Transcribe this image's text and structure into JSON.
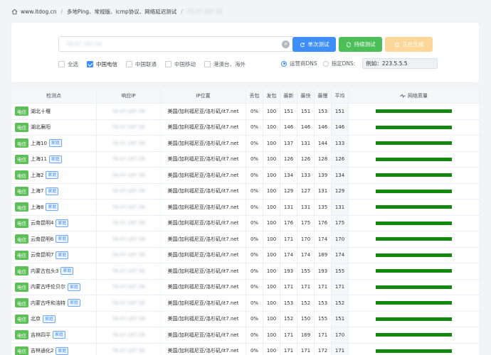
{
  "breadcrumb": {
    "site": "www.itdog.cn",
    "page": "多地Ping、常规版、icmp协议、网络延迟测试",
    "target": "78.47.187.56"
  },
  "search": {
    "value": "78.47.187.56"
  },
  "buttons": {
    "single": "单次测试",
    "continuous": "持续测试",
    "generating": "正在生成"
  },
  "filters": [
    {
      "label": "全选",
      "checked": false
    },
    {
      "label": "中国电信",
      "checked": true
    },
    {
      "label": "中国联通",
      "checked": false
    },
    {
      "label": "中国移动",
      "checked": false
    },
    {
      "label": "港澳台、海外",
      "checked": false
    }
  ],
  "dns": {
    "isp_label": "运营商DNS",
    "custom_label": "指定DNS:",
    "custom_placeholder": "例如：223.5.5.5",
    "selected": "isp"
  },
  "table": {
    "headers": [
      "检测点",
      "响应IP",
      "IP位置",
      "丢包",
      "发包",
      "最新",
      "最快",
      "最慢",
      "平均",
      "网络质量"
    ],
    "rows": [
      {
        "isp": "电信",
        "node": "湖北十堰",
        "home": false,
        "ip": "78.47.187.56",
        "loc": "美国/加利福尼亚/洛杉矶/it7.net",
        "loss": "0%",
        "sent": "100",
        "last": "151",
        "best": "151",
        "worst": "153",
        "avg": "151"
      },
      {
        "isp": "电信",
        "node": "湖北襄阳",
        "home": false,
        "ip": "78.47.187.56",
        "loc": "美国/加利福尼亚/洛杉矶/it7.net",
        "loss": "0%",
        "sent": "100",
        "last": "146",
        "best": "146",
        "worst": "146",
        "avg": "146"
      },
      {
        "isp": "电信",
        "node": "上海10",
        "home": true,
        "ip": "78.47.187.56",
        "loc": "美国/加利福尼亚/洛杉矶/it7.net",
        "loss": "0%",
        "sent": "100",
        "last": "137",
        "best": "131",
        "worst": "144",
        "avg": "133"
      },
      {
        "isp": "电信",
        "node": "上海11",
        "home": true,
        "ip": "78.47.187.56",
        "loc": "美国/加利福尼亚/洛杉矶/it7.net",
        "loss": "0%",
        "sent": "100",
        "last": "126",
        "best": "126",
        "worst": "128",
        "avg": "126"
      },
      {
        "isp": "电信",
        "node": "上海2",
        "home": true,
        "ip": "78.47.187.56",
        "loc": "美国/加利福尼亚/洛杉矶/it7.net",
        "loss": "0%",
        "sent": "100",
        "last": "134",
        "best": "133",
        "worst": "139",
        "avg": "134"
      },
      {
        "isp": "电信",
        "node": "上海7",
        "home": true,
        "ip": "78.47.187.56",
        "loc": "美国/加利福尼亚/洛杉矶/it7.net",
        "loss": "0%",
        "sent": "100",
        "last": "129",
        "best": "127",
        "worst": "131",
        "avg": "129"
      },
      {
        "isp": "电信",
        "node": "上海8",
        "home": true,
        "ip": "78.47.187.56",
        "loc": "美国/加利福尼亚/洛杉矶/it7.net",
        "loss": "0%",
        "sent": "100",
        "last": "131",
        "best": "131",
        "worst": "135",
        "avg": "131"
      },
      {
        "isp": "电信",
        "node": "云南昆明4",
        "home": true,
        "ip": "78.47.187.56",
        "loc": "美国/加利福尼亚/洛杉矶/it7.net",
        "loss": "0%",
        "sent": "100",
        "last": "176",
        "best": "175",
        "worst": "176",
        "avg": "175"
      },
      {
        "isp": "电信",
        "node": "云南昆明6",
        "home": true,
        "ip": "78.47.187.56",
        "loc": "美国/加利福尼亚/洛杉矶/it7.net",
        "loss": "0%",
        "sent": "100",
        "last": "171",
        "best": "170",
        "worst": "174",
        "avg": "170"
      },
      {
        "isp": "电信",
        "node": "云南昆明7",
        "home": true,
        "ip": "78.47.187.56",
        "loc": "美国/加利福尼亚/洛杉矶/it7.net",
        "loss": "0%",
        "sent": "100",
        "last": "174",
        "best": "174",
        "worst": "189",
        "avg": "174"
      },
      {
        "isp": "电信",
        "node": "内蒙古包头3",
        "home": true,
        "ip": "78.47.187.56",
        "loc": "美国/加利福尼亚/洛杉矶/it7.net",
        "loss": "0%",
        "sent": "100",
        "last": "193",
        "best": "155",
        "worst": "193",
        "avg": "155"
      },
      {
        "isp": "电信",
        "node": "内蒙古呼伦贝尔",
        "home": true,
        "ip": "78.47.187.56",
        "loc": "美国/加利福尼亚/洛杉矶/it7.net",
        "loss": "0%",
        "sent": "100",
        "last": "171",
        "best": "171",
        "worst": "171",
        "avg": "171"
      },
      {
        "isp": "电信",
        "node": "内蒙古呼和浩特",
        "home": true,
        "ip": "78.47.187.56",
        "loc": "美国/加利福尼亚/洛杉矶/it7.net",
        "loss": "0%",
        "sent": "100",
        "last": "153",
        "best": "152",
        "worst": "153",
        "avg": "152"
      },
      {
        "isp": "电信",
        "node": "北京",
        "home": true,
        "ip": "78.47.187.56",
        "loc": "美国/加利福尼亚/洛杉矶/it7.net",
        "loss": "0%",
        "sent": "100",
        "last": "152",
        "best": "150",
        "worst": "155",
        "avg": "151"
      },
      {
        "isp": "电信",
        "node": "吉林四平",
        "home": true,
        "ip": "78.47.187.56",
        "loc": "美国/加利福尼亚/洛杉矶/it7.net",
        "loss": "0%",
        "sent": "100",
        "last": "171",
        "best": "169",
        "worst": "171",
        "avg": "170"
      },
      {
        "isp": "电信",
        "node": "吉林通化2",
        "home": true,
        "ip": "78.47.187.56",
        "loc": "美国/加利福尼亚/洛杉矶/it7.net",
        "loss": "0%",
        "sent": "100",
        "last": "171",
        "best": "171",
        "worst": "172",
        "avg": "171"
      }
    ],
    "home_tag": "家庭"
  },
  "colors": {
    "primary": "#3e8ef7",
    "success": "#4cbf58",
    "warning_light": "#fbd89a",
    "quality_bar": "#13880f"
  }
}
